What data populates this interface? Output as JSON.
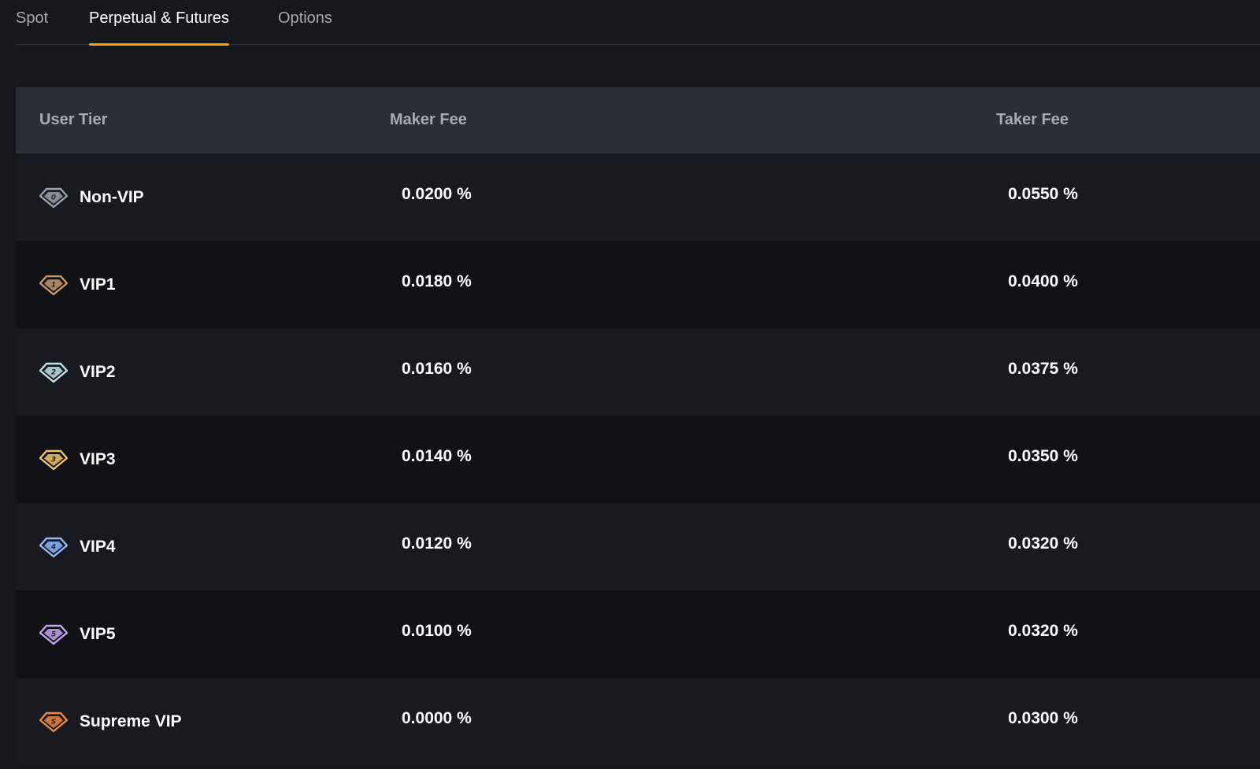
{
  "tabs": [
    {
      "label": "Spot",
      "active": false
    },
    {
      "label": "Perpetual & Futures",
      "active": true
    },
    {
      "label": "Options",
      "active": false
    }
  ],
  "colors": {
    "accent": "#f7a600",
    "background": "#17181c",
    "header_bg": "#2b2f35"
  },
  "table": {
    "headers": {
      "tier": "User Tier",
      "maker": "Maker Fee",
      "taker": "Taker Fee"
    },
    "rows": [
      {
        "tier": "Non-VIP",
        "badge": "0",
        "icon": "vip-0-badge-icon",
        "color": "#9ea2a8",
        "maker": "0.0200 %",
        "taker": "0.0550 %"
      },
      {
        "tier": "VIP1",
        "badge": "1",
        "icon": "vip-1-badge-icon",
        "color": "#c99a6a",
        "maker": "0.0180 %",
        "taker": "0.0400 %"
      },
      {
        "tier": "VIP2",
        "badge": "2",
        "icon": "vip-2-badge-icon",
        "color": "#bfe3e6",
        "maker": "0.0160 %",
        "taker": "0.0375 %"
      },
      {
        "tier": "VIP3",
        "badge": "3",
        "icon": "vip-3-badge-icon",
        "color": "#f3c463",
        "maker": "0.0140 %",
        "taker": "0.0350 %"
      },
      {
        "tier": "VIP4",
        "badge": "4",
        "icon": "vip-4-badge-icon",
        "color": "#8fb8ff",
        "maker": "0.0120 %",
        "taker": "0.0320 %"
      },
      {
        "tier": "VIP5",
        "badge": "5",
        "icon": "vip-5-badge-icon",
        "color": "#c7a6f2",
        "maker": "0.0100 %",
        "taker": "0.0320 %"
      },
      {
        "tier": "Supreme VIP",
        "badge": "S",
        "icon": "supreme-vip-badge-icon",
        "color": "#f08a3c",
        "maker": "0.0000 %",
        "taker": "0.0300 %"
      }
    ]
  }
}
